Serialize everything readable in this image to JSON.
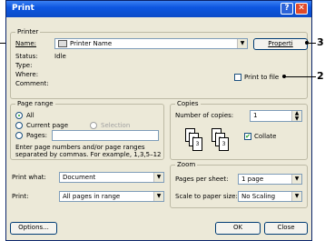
{
  "window": {
    "title": "Print",
    "help_glyph": "?",
    "close_glyph": "✕"
  },
  "printer": {
    "group_label": "Printer",
    "name_label": "Name:",
    "name_value": "Printer Name",
    "properties_label": "Properti",
    "status_label": "Status:",
    "status_value": "Idle",
    "type_label": "Type:",
    "where_label": "Where:",
    "comment_label": "Comment:",
    "print_to_file_label": "Print to file"
  },
  "page_range": {
    "group_label": "Page range",
    "options": [
      "All",
      "Current page",
      "Selection",
      "Pages:"
    ],
    "selected": "All",
    "hint": "Enter page numbers and/or page ranges separated by commas. For example, 1,3,5–12"
  },
  "copies": {
    "group_label": "Copies",
    "number_label": "Number of copies:",
    "number_value": "1",
    "collate_label": "Collate",
    "collate_checked": true
  },
  "print_what": {
    "label": "Print what:",
    "value": "Document"
  },
  "print": {
    "label": "Print:",
    "value": "All pages in range"
  },
  "zoom": {
    "group_label": "Zoom",
    "pages_per_sheet_label": "Pages per sheet:",
    "pages_per_sheet_value": "1 page",
    "scale_label": "Scale to paper size:",
    "scale_value": "No Scaling"
  },
  "buttons": {
    "options": "Options...",
    "ok": "OK",
    "close": "Close"
  },
  "callouts": {
    "c3": "3",
    "c2": "2"
  },
  "collate_pages": [
    "1",
    "2",
    "3",
    "1",
    "2",
    "3"
  ]
}
